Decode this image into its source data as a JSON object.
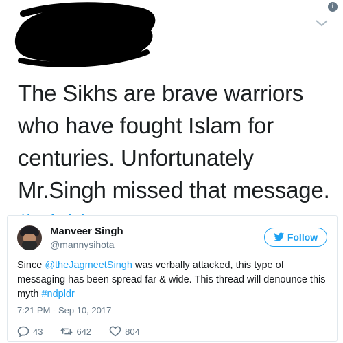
{
  "header": {
    "info_icon_glyph": "i",
    "info_icon": "info-icon",
    "menu_icon": "chevron-down-icon"
  },
  "quoted_tweet": {
    "text_parts": [
      "The Sikhs are brave warriors who have fought Islam for centuries. Unfortunately Mr.Singh missed that message. "
    ],
    "hashtag": "#ndpldr"
  },
  "embedded_tweet": {
    "author_name": "Manveer Singh",
    "author_handle": "@mannysihota",
    "follow_label": "Follow",
    "text_before": "Since ",
    "mention": "@theJagmeetSingh",
    "text_middle": " was verbally attacked, this type of messaging has been spread far & wide. This thread will denounce this myth ",
    "hashtag": "#ndpldr",
    "timestamp": "7:21 PM - Sep 10, 2017",
    "replies": "43",
    "retweets": "642",
    "likes": "804"
  },
  "colors": {
    "accent": "#1da1f2",
    "muted": "#657786",
    "text": "#14171a",
    "border": "#e1e8ed",
    "redaction": "#000000"
  }
}
